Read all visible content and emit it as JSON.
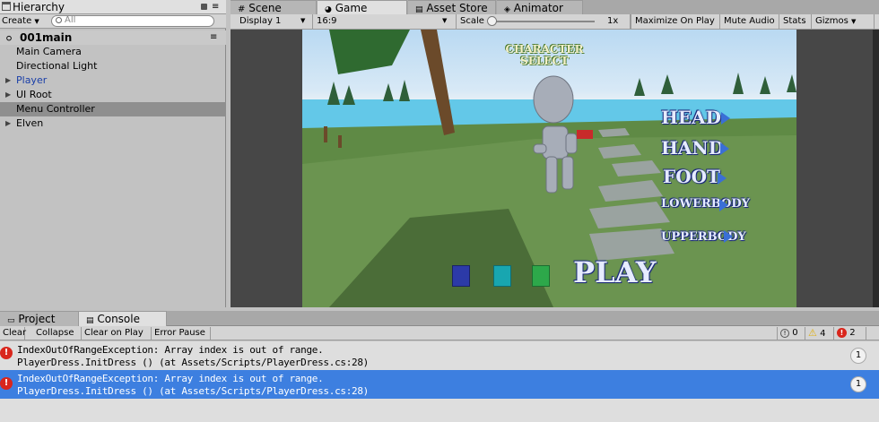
{
  "tabs": {
    "hierarchy": "Hierarchy",
    "scene": "Scene",
    "game": "Game",
    "asset_store": "Asset Store",
    "animator": "Animator",
    "project": "Project",
    "console": "Console"
  },
  "hierarchy": {
    "create_label": "Create",
    "search_placeholder": "All",
    "scene_name": "001main",
    "items": [
      {
        "label": "Main Camera"
      },
      {
        "label": "Directional Light"
      },
      {
        "label": "Player"
      },
      {
        "label": "UI Root"
      },
      {
        "label": "Menu Controller"
      },
      {
        "label": "Elven"
      }
    ]
  },
  "game_toolbar": {
    "display": "Display 1",
    "aspect": "16:9",
    "scale_label": "Scale",
    "scale_value": "1x",
    "maximize": "Maximize On Play",
    "mute": "Mute Audio",
    "stats": "Stats",
    "gizmos": "Gizmos"
  },
  "game_view": {
    "title_line1": "CHARACTER",
    "title_line2": "SELECT",
    "menu": [
      "HEAD",
      "HAND",
      "FOOT",
      "LOWERBODY",
      "UPPERBODY"
    ],
    "play": "PLAY",
    "swatches": [
      "#2c3aa8",
      "#18a6b0",
      "#2da84a"
    ]
  },
  "console": {
    "clear": "Clear",
    "collapse": "Collapse",
    "clear_on_play": "Clear on Play",
    "error_pause": "Error Pause",
    "info_count": "0",
    "warn_count": "4",
    "error_count": "2",
    "messages": [
      {
        "line1": "IndexOutOfRangeException: Array index is out of range.",
        "line2": "PlayerDress.InitDress () (at Assets/Scripts/PlayerDress.cs:28)",
        "count": "1"
      },
      {
        "line1": "IndexOutOfRangeException: Array index is out of range.",
        "line2": "PlayerDress.InitDress () (at Assets/Scripts/PlayerDress.cs:28)",
        "count": "1"
      }
    ]
  },
  "colors": {
    "selection": "#3d7fe0",
    "error": "#d9261c",
    "warning": "#f2c21a"
  }
}
